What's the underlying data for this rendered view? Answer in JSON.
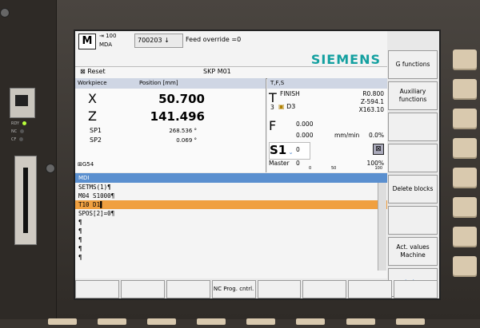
{
  "header": {
    "mode_icon": "M",
    "override_pct": "100",
    "mode": "MDA",
    "program_num": "700203",
    "program_arrow": "↓",
    "message": "Feed override =0"
  },
  "brand": "SIEMENS",
  "status": {
    "reset": "Reset",
    "program": "SKP M01"
  },
  "workpiece": {
    "title": "Workpiece",
    "pos_title": "Position [mm]",
    "axes": [
      {
        "name": "X",
        "value": "50.700"
      },
      {
        "name": "Z",
        "value": "141.496"
      }
    ],
    "spindles": [
      {
        "name": "SP1",
        "value": "268.536 °"
      },
      {
        "name": "SP2",
        "value": "0.069 °"
      }
    ],
    "frame": "G54"
  },
  "tfs": {
    "title": "T,F,S",
    "tool_letter": "T",
    "tool_name": "FINISH",
    "tool_num": "3",
    "tool_d": "D3",
    "radius": "R0.800",
    "z": "Z-594.1",
    "x": "X163.10",
    "feed_letter": "F",
    "feed1": "0.000",
    "feed2": "0.000",
    "feed_unit": "mm/min",
    "feed_pct": "0.0%",
    "spindle": "S1",
    "spindle_val": "0",
    "master": "Master",
    "master_val": "0",
    "tick0": "0",
    "tick50": "50",
    "tick100": "100",
    "spindle_pct": "100%"
  },
  "mdi": {
    "title": "MDI",
    "lines": [
      "SETMS(1)¶",
      "M04 S1000¶",
      "T10 D1▌",
      "SPOS[2]=0¶",
      "¶",
      "¶",
      "¶",
      "¶",
      "¶"
    ]
  },
  "softkeys_v": [
    "G functions",
    "Auxiliary functions",
    "",
    "",
    "Delete blocks",
    "",
    "Act. values Machine",
    "▶▶"
  ],
  "softkeys_h": [
    "",
    "",
    "",
    "NC Prog. cntrl.",
    "",
    "",
    "",
    ""
  ]
}
